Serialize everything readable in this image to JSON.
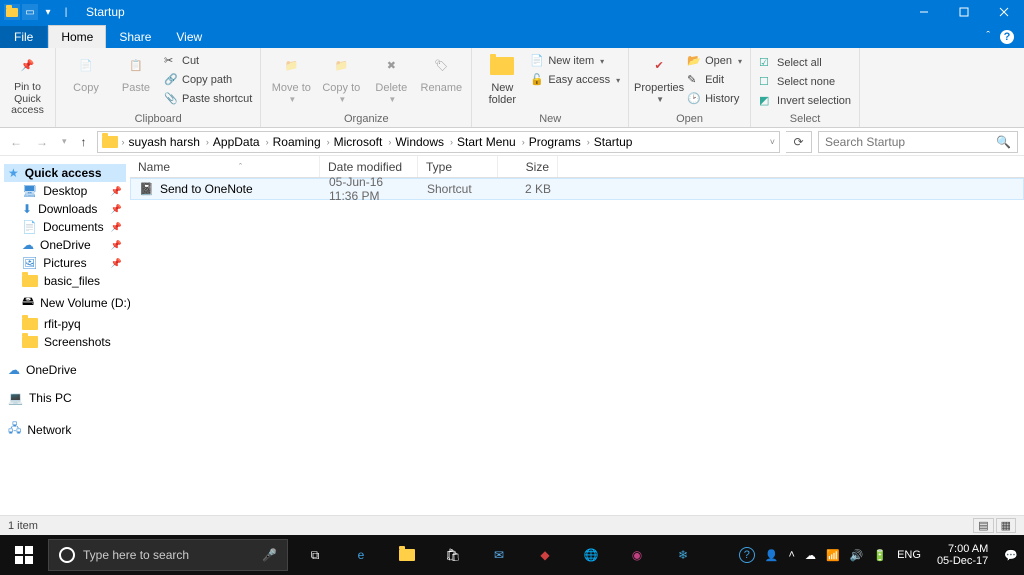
{
  "window": {
    "title": "Startup"
  },
  "tabs": {
    "file": "File",
    "home": "Home",
    "share": "Share",
    "view": "View"
  },
  "ribbon": {
    "pin": "Pin to Quick access",
    "copy": "Copy",
    "paste": "Paste",
    "cut": "Cut",
    "copypath": "Copy path",
    "pasteshortcut": "Paste shortcut",
    "moveto": "Move to",
    "copyto": "Copy to",
    "delete": "Delete",
    "rename": "Rename",
    "newfolder": "New folder",
    "newitem": "New item",
    "easyaccess": "Easy access",
    "properties": "Properties",
    "open": "Open",
    "edit": "Edit",
    "history": "History",
    "selectall": "Select all",
    "selectnone": "Select none",
    "invert": "Invert selection",
    "g_clipboard": "Clipboard",
    "g_organize": "Organize",
    "g_new": "New",
    "g_open": "Open",
    "g_select": "Select"
  },
  "breadcrumb": [
    "suyash harsh",
    "AppData",
    "Roaming",
    "Microsoft",
    "Windows",
    "Start Menu",
    "Programs",
    "Startup"
  ],
  "search": {
    "placeholder": "Search Startup"
  },
  "columns": {
    "name": "Name",
    "date": "Date modified",
    "type": "Type",
    "size": "Size"
  },
  "files": [
    {
      "name": "Send to OneNote",
      "date": "05-Jun-16 11:36 PM",
      "type": "Shortcut",
      "size": "2 KB"
    }
  ],
  "nav": {
    "quick": "Quick access",
    "items": [
      "Desktop",
      "Downloads",
      "Documents",
      "OneDrive",
      "Pictures",
      "basic_files",
      "New Volume (D:)",
      "rfit-pyq",
      "Screenshots"
    ],
    "onedrive": "OneDrive",
    "thispc": "This PC",
    "network": "Network"
  },
  "status": {
    "count": "1 item"
  },
  "taskbar": {
    "search": "Type here to search",
    "clock": {
      "time": "7:00 AM",
      "date": "05-Dec-17"
    },
    "lang": "ENG"
  }
}
